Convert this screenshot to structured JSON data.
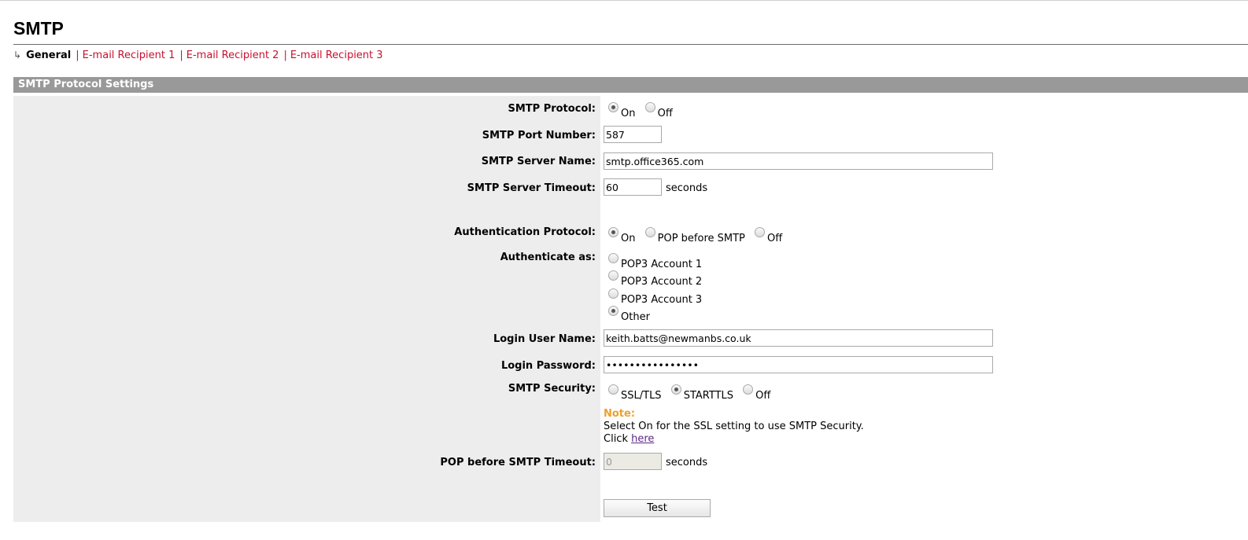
{
  "page": {
    "title": "SMTP"
  },
  "subnav": {
    "current": "General",
    "links": [
      "E-mail Recipient 1",
      "E-mail Recipient 2",
      "E-mail Recipient 3"
    ],
    "separator": "|",
    "arrow_icon": "↳"
  },
  "section": {
    "header": "SMTP Protocol Settings"
  },
  "form": {
    "smtp_protocol": {
      "label": "SMTP Protocol:",
      "options": [
        "On",
        "Off"
      ],
      "selected": "On"
    },
    "smtp_port": {
      "label": "SMTP Port Number:",
      "value": "587"
    },
    "smtp_server_name": {
      "label": "SMTP Server Name:",
      "value": "smtp.office365.com"
    },
    "smtp_server_timeout": {
      "label": "SMTP Server Timeout:",
      "value": "60",
      "unit": "seconds"
    },
    "auth_protocol": {
      "label": "Authentication Protocol:",
      "options": [
        "On",
        "POP before SMTP",
        "Off"
      ],
      "selected": "On"
    },
    "authenticate_as": {
      "label": "Authenticate as:",
      "options": [
        "POP3 Account 1",
        "POP3 Account 2",
        "POP3 Account 3",
        "Other"
      ],
      "selected": "Other"
    },
    "login_user": {
      "label": "Login User Name:",
      "value": "keith.batts@newmanbs.co.uk"
    },
    "login_password": {
      "label": "Login Password:",
      "value": "••••••••••••••••"
    },
    "smtp_security": {
      "label": "SMTP Security:",
      "options": [
        "SSL/TLS",
        "STARTTLS",
        "Off"
      ],
      "selected": "STARTTLS"
    },
    "note": {
      "title": "Note:",
      "text": "Select On for the SSL setting to use SMTP Security.",
      "click_prefix": "Click",
      "link": "here"
    },
    "pop_timeout": {
      "label": "POP before SMTP Timeout:",
      "value": "0",
      "unit": "seconds",
      "disabled": true
    },
    "test_button": "Test"
  },
  "colors": {
    "link_red": "#c8102e",
    "note_orange": "#f0a02c",
    "section_header_bg": "#999999",
    "label_column_bg": "#ededed"
  }
}
